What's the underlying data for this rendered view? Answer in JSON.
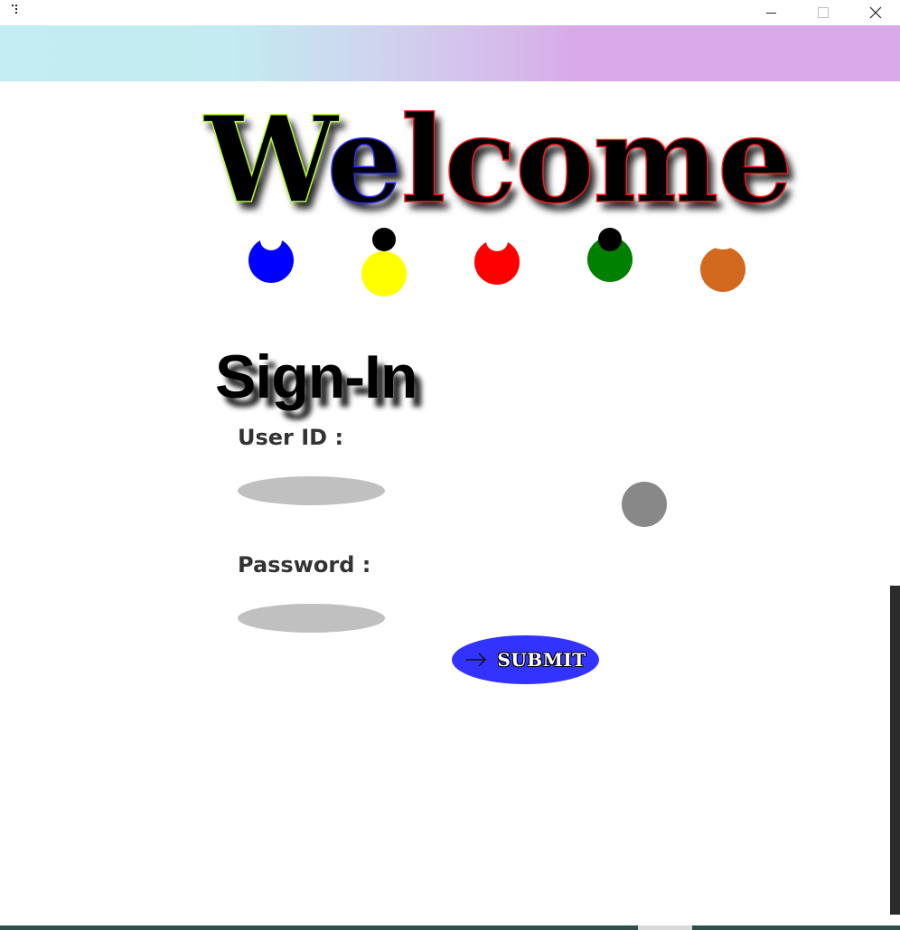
{
  "window": {
    "icon": "app-icon",
    "minimize_icon": "minimize-icon",
    "maximize_icon": "maximize-icon",
    "close_icon": "close-icon"
  },
  "banner": {
    "gradient_colors": [
      "#c3edf2",
      "#cfd4ef",
      "#d9a9e9"
    ]
  },
  "welcome": {
    "letters": [
      "W",
      "e",
      "lcome"
    ],
    "stroke_colors": [
      "#b6ff2a",
      "#3030ff",
      "#ff1a1a"
    ]
  },
  "dots": [
    {
      "color": "#0000ff",
      "accent": "#ffffff"
    },
    {
      "color": "#ffff00",
      "accent": "#000000"
    },
    {
      "color": "#ff0000",
      "accent": "#ffffff"
    },
    {
      "color": "#008000",
      "accent": "#000000"
    },
    {
      "color": "#d2691e",
      "accent": "#ffffff"
    }
  ],
  "signin": {
    "title": "Sign-In",
    "user_id_label": "User ID :",
    "user_id_value": "",
    "password_label": "Password :",
    "password_value": "",
    "submit_label": "SUBMIT",
    "submit_icon": "arrow-right-icon",
    "submit_color": "#3333ff"
  }
}
